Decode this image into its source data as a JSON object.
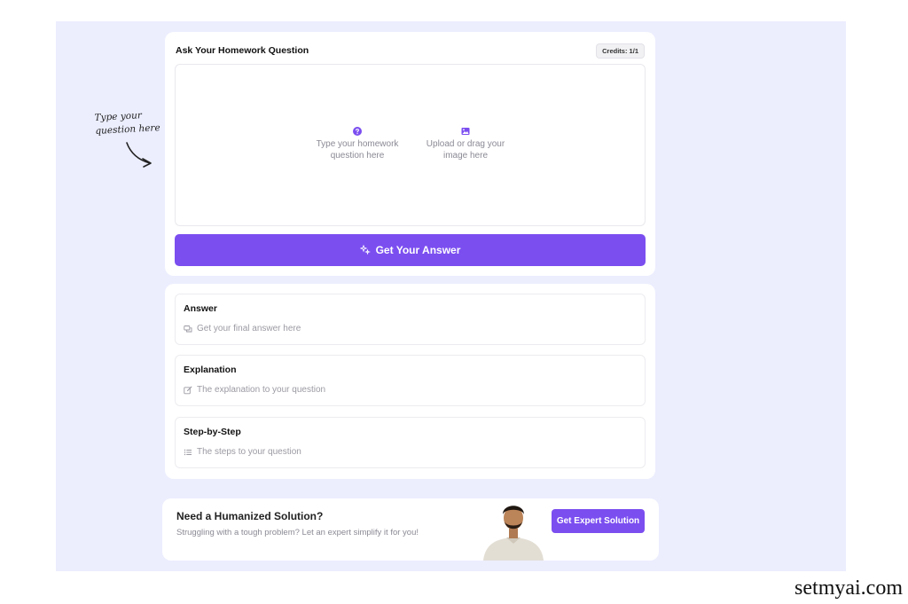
{
  "hint": {
    "line1": "Type your",
    "line2": "question here"
  },
  "ask_card": {
    "title": "Ask Your Homework Question",
    "credits": "Credits: 1/1",
    "type_option": {
      "line1": "Type your homework",
      "line2": "question here",
      "icon": "question-circle-icon"
    },
    "upload_option": {
      "line1": "Upload or drag your",
      "line2": "image here",
      "icon": "image-icon"
    },
    "submit_label": "Get Your Answer"
  },
  "results": [
    {
      "title": "Answer",
      "placeholder": "Get your final answer here",
      "icon": "chat-icon"
    },
    {
      "title": "Explanation",
      "placeholder": "The explanation to your question",
      "icon": "edit-icon"
    },
    {
      "title": "Step-by-Step",
      "placeholder": "The steps to your question",
      "icon": "list-icon"
    }
  ],
  "expert": {
    "title": "Need a Humanized Solution?",
    "description": "Struggling with a tough problem? Let an expert simplify it for you!",
    "button_label": "Get Expert Solution"
  },
  "watermark": "setmyai.com",
  "colors": {
    "accent": "#7b4ef0",
    "background": "#eceefe",
    "card": "#ffffff"
  }
}
